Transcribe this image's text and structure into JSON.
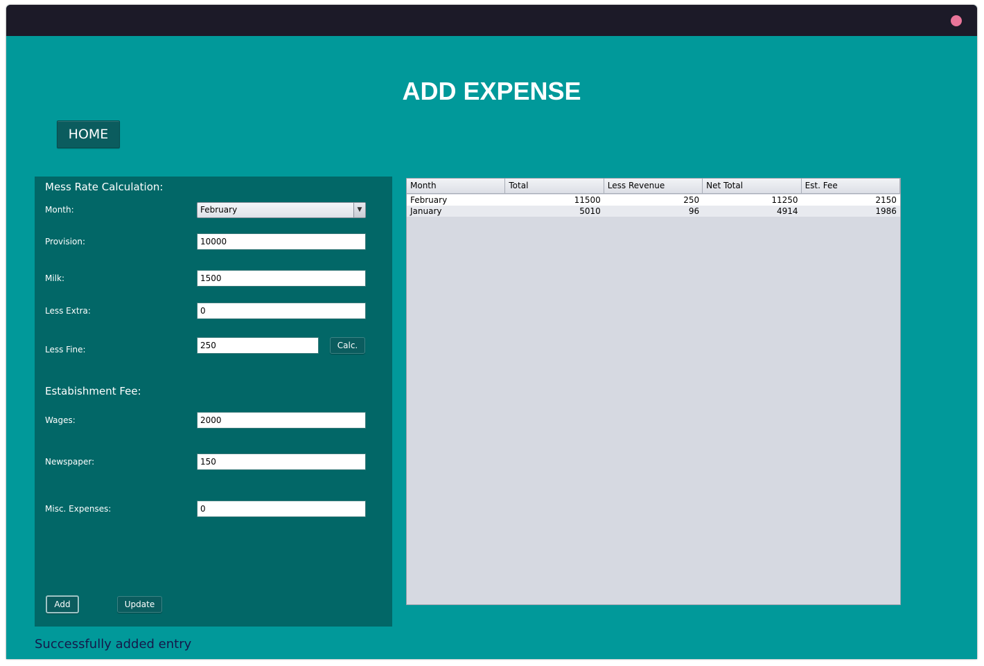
{
  "window": {
    "close_icon": "close-circle-icon",
    "close_color": "#e9759a"
  },
  "header": {
    "title": "ADD EXPENSE",
    "home_label": "HOME"
  },
  "form": {
    "mess_section_title": "Mess Rate Calculation:",
    "month": {
      "label": "Month:",
      "value": "February",
      "arrow_icon": "chevron-down-icon"
    },
    "provision": {
      "label": "Provision:",
      "value": "10000"
    },
    "milk": {
      "label": "Milk:",
      "value": "1500"
    },
    "less_extra": {
      "label": "Less Extra:",
      "value": "0"
    },
    "less_fine": {
      "label": "Less Fine:",
      "value": "250"
    },
    "calc_label": "Calc.",
    "est_section_title": "Estabishment Fee:",
    "wages": {
      "label": "Wages:",
      "value": "2000"
    },
    "newspaper": {
      "label": "Newspaper:",
      "value": "150"
    },
    "misc": {
      "label": "Misc. Expenses:",
      "value": "0"
    },
    "add_label": "Add",
    "update_label": "Update"
  },
  "status": "Successfully added entry",
  "table": {
    "headers": [
      "Month",
      "Total",
      "Less Revenue",
      "Net Total",
      "Est. Fee"
    ],
    "rows": [
      [
        "February",
        "11500",
        "250",
        "11250",
        "2150"
      ],
      [
        "January",
        "5010",
        "96",
        "4914",
        "1986"
      ]
    ]
  },
  "colors": {
    "window_bg": "#01999a",
    "panel_bg": "#026767",
    "titlebar": "#1c1a28",
    "button_bg": "#0b5c5e",
    "status_text": "#15184a"
  }
}
